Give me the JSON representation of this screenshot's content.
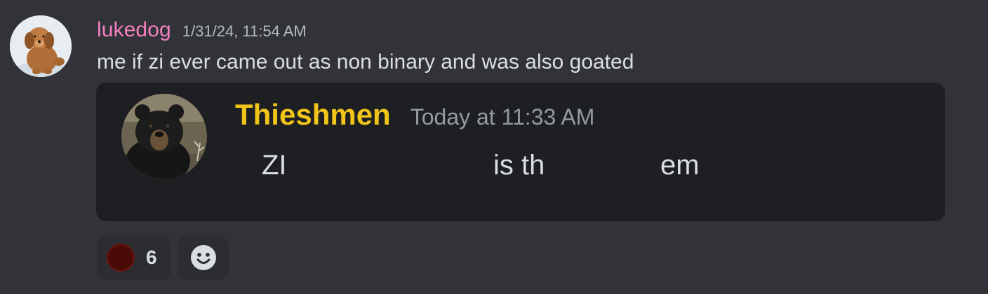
{
  "message": {
    "author": "lukedog",
    "timestamp": "1/31/24, 11:54 AM",
    "content": "me if zi ever came out as non binary and was also goated",
    "author_color": "#f47fbf"
  },
  "embed": {
    "author": "Thieshmen",
    "timestamp": "Today at 11:33 AM",
    "text_fragments": [
      "ZI",
      "is th",
      "em"
    ],
    "author_color": "#f0c419"
  },
  "reactions": [
    {
      "emoji": "dark-red-circle-emoji",
      "count": "6"
    }
  ],
  "add_reaction": {
    "icon": "smiley-add-reaction-icon"
  },
  "colors": {
    "background": "#313338",
    "embed_background": "#1e1f22",
    "reaction_background": "#2b2d31"
  }
}
